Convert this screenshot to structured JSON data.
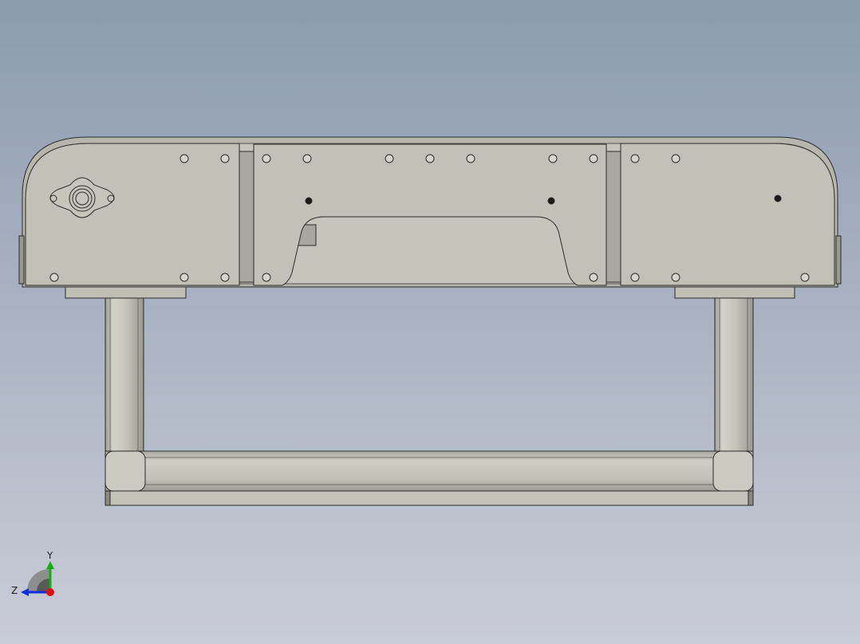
{
  "viewport": {
    "background_top": "#8c9bb0",
    "background_bottom": "#c9ccd6",
    "part_fill": "#c0bfb5",
    "part_edge": "#2a2a2a"
  },
  "triad": {
    "y_label": "Y",
    "z_label": "Z",
    "x_color": "#e01010",
    "y_color": "#10b010",
    "z_color": "#1030e0"
  }
}
